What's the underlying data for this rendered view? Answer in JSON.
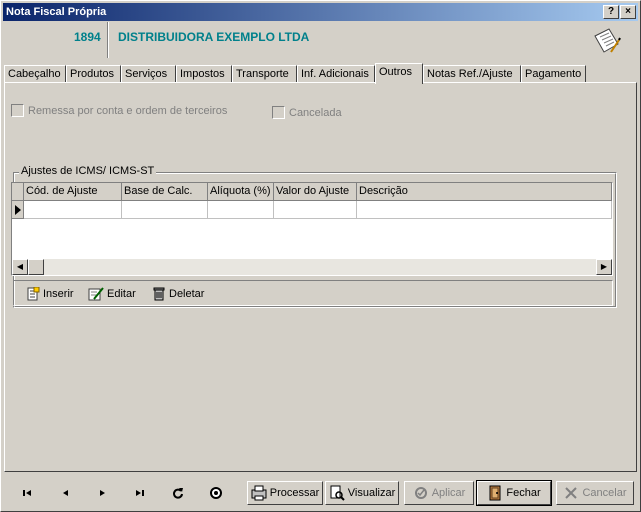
{
  "window": {
    "title": "Nota Fiscal Própria",
    "help_label": "?",
    "close_label": "×"
  },
  "header": {
    "code": "1894",
    "company": "DISTRIBUIDORA EXEMPLO LTDA"
  },
  "tabs": [
    {
      "label": "Cabeçalho",
      "active": false
    },
    {
      "label": "Produtos",
      "active": false
    },
    {
      "label": "Serviços",
      "active": false
    },
    {
      "label": "Impostos",
      "active": false
    },
    {
      "label": "Transporte",
      "active": false
    },
    {
      "label": "Inf. Adicionais",
      "active": false
    },
    {
      "label": "Outros",
      "active": true
    },
    {
      "label": "Notas Ref./Ajuste",
      "active": false
    },
    {
      "label": "Pagamento",
      "active": false
    }
  ],
  "options": {
    "remessa_label": "Remessa por conta e ordem de terceiros",
    "remessa_checked": false,
    "cancelada_label": "Cancelada",
    "cancelada_checked": false
  },
  "ajustes": {
    "group_title": "Ajustes de ICMS/ ICMS-ST",
    "columns": [
      "Cód. de Ajuste",
      "Base de Calc.",
      "Alíquota (%)",
      "Valor do Ajuste",
      "Descrição"
    ],
    "rows": [
      [
        "",
        "",
        "",
        "",
        ""
      ]
    ],
    "actions": {
      "insert": "Inserir",
      "edit": "Editar",
      "delete": "Deletar"
    }
  },
  "footer": {
    "processar": "Processar",
    "visualizar": "Visualizar",
    "aplicar": "Aplicar",
    "fechar": "Fechar",
    "cancelar": "Cancelar",
    "nav_icons": [
      "first-record-icon",
      "prior-record-icon",
      "next-record-icon",
      "last-record-icon",
      "refresh-icon",
      "record-icon"
    ]
  },
  "colors": {
    "accent_text": "#00808b",
    "title_gradient_start": "#0a246a",
    "title_gradient_end": "#a6caf0"
  }
}
